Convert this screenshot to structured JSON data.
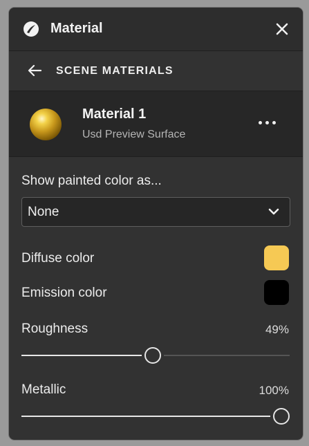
{
  "header": {
    "title": "Material",
    "logo_icon": "app-logo-icon",
    "close_icon": "close-icon"
  },
  "nav": {
    "label": "SCENE MATERIALS",
    "back_icon": "arrow-left-icon"
  },
  "material": {
    "name": "Material 1",
    "type": "Usd Preview Surface",
    "more_icon": "more-horizontal-icon"
  },
  "painted": {
    "label": "Show painted color as...",
    "value": "None"
  },
  "diffuse": {
    "label": "Diffuse color",
    "color": "#F6C954"
  },
  "emission": {
    "label": "Emission color",
    "color": "#000000"
  },
  "roughness": {
    "label": "Roughness",
    "value_text": "49%",
    "value": 0.49
  },
  "metallic": {
    "label": "Metallic",
    "value_text": "100%",
    "value": 1.0
  }
}
